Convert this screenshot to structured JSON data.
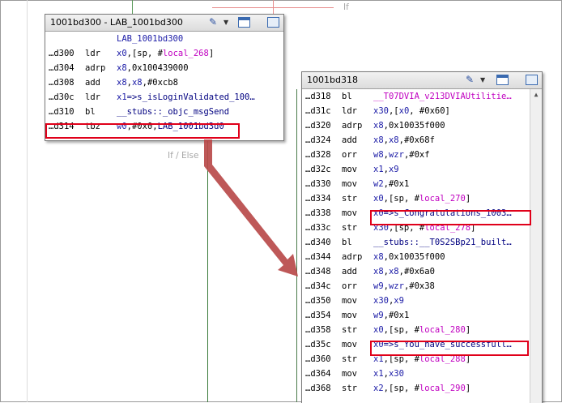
{
  "edge_labels": {
    "top_right": "If",
    "if_else": "If / Else"
  },
  "blockA": {
    "title": "1001bd300 - LAB_1001bd300",
    "label": "LAB_1001bd300",
    "rows": [
      {
        "addr": "…d300",
        "mn": "ldr",
        "op": [
          [
            "x0",
            "blue"
          ],
          [
            ",[sp, #",
            ""
          ],
          [
            "local_268",
            "mag"
          ],
          [
            "]",
            ""
          ]
        ]
      },
      {
        "addr": "…d304",
        "mn": "adrp",
        "op": [
          [
            "x8",
            "blue"
          ],
          [
            ",0x100439000",
            ""
          ]
        ]
      },
      {
        "addr": "…d308",
        "mn": "add",
        "op": [
          [
            "x8",
            "blue"
          ],
          [
            ",",
            ""
          ],
          [
            "x8",
            "blue"
          ],
          [
            ",#0xcb8",
            ""
          ]
        ]
      },
      {
        "addr": "…d30c",
        "mn": "ldr",
        "op": [
          [
            "x1",
            "blue"
          ],
          [
            "=>s_isLoginValidated_100…",
            "navy"
          ]
        ]
      },
      {
        "addr": "…d310",
        "mn": "bl",
        "op": [
          [
            "__stubs::_objc_msgSend",
            "navy"
          ]
        ]
      },
      {
        "addr": "…d314",
        "mn": "tbz",
        "op": [
          [
            "w0",
            "blue"
          ],
          [
            ",#0x0,",
            ""
          ],
          [
            "LAB_1001bd3d0",
            "navy"
          ]
        ]
      }
    ]
  },
  "blockB": {
    "title": "1001bd318",
    "rows": [
      {
        "addr": "…d318",
        "mn": "bl",
        "op": [
          [
            "__T07DVIA_v213DVIAUtilitie…",
            "mag"
          ]
        ]
      },
      {
        "addr": "…d31c",
        "mn": "ldr",
        "op": [
          [
            "x30",
            "blue"
          ],
          [
            ",[",
            ""
          ],
          [
            "x0",
            "blue"
          ],
          [
            ", #0x60]",
            ""
          ]
        ]
      },
      {
        "addr": "…d320",
        "mn": "adrp",
        "op": [
          [
            "x8",
            "blue"
          ],
          [
            ",0x10035f000",
            ""
          ]
        ]
      },
      {
        "addr": "…d324",
        "mn": "add",
        "op": [
          [
            "x8",
            "blue"
          ],
          [
            ",",
            ""
          ],
          [
            "x8",
            "blue"
          ],
          [
            ",#0x68f",
            ""
          ]
        ]
      },
      {
        "addr": "…d328",
        "mn": "orr",
        "op": [
          [
            "w8",
            "blue"
          ],
          [
            ",",
            ""
          ],
          [
            "wzr",
            "blue"
          ],
          [
            ",#0xf",
            ""
          ]
        ]
      },
      {
        "addr": "…d32c",
        "mn": "mov",
        "op": [
          [
            "x1",
            "blue"
          ],
          [
            ",",
            ""
          ],
          [
            "x9",
            "blue"
          ]
        ]
      },
      {
        "addr": "…d330",
        "mn": "mov",
        "op": [
          [
            "w2",
            "blue"
          ],
          [
            ",#0x1",
            ""
          ]
        ]
      },
      {
        "addr": "…d334",
        "mn": "str",
        "op": [
          [
            "x0",
            "blue"
          ],
          [
            ",[sp, #",
            ""
          ],
          [
            "local_270",
            "mag"
          ],
          [
            "]",
            ""
          ]
        ]
      },
      {
        "addr": "…d338",
        "mn": "mov",
        "op": [
          [
            "x0",
            "blue"
          ],
          [
            "=>s_Congratulations_1003…",
            "navy"
          ]
        ]
      },
      {
        "addr": "…d33c",
        "mn": "str",
        "op": [
          [
            "x30",
            "blue"
          ],
          [
            ",[sp, #",
            ""
          ],
          [
            "local_278",
            "mag"
          ],
          [
            "]",
            ""
          ]
        ]
      },
      {
        "addr": "…d340",
        "mn": "bl",
        "op": [
          [
            "__stubs::__T0S2SBp21_built…",
            "navy"
          ]
        ]
      },
      {
        "addr": "…d344",
        "mn": "adrp",
        "op": [
          [
            "x8",
            "blue"
          ],
          [
            ",0x10035f000",
            ""
          ]
        ]
      },
      {
        "addr": "…d348",
        "mn": "add",
        "op": [
          [
            "x8",
            "blue"
          ],
          [
            ",",
            ""
          ],
          [
            "x8",
            "blue"
          ],
          [
            ",#0x6a0",
            ""
          ]
        ]
      },
      {
        "addr": "…d34c",
        "mn": "orr",
        "op": [
          [
            "w9",
            "blue"
          ],
          [
            ",",
            ""
          ],
          [
            "wzr",
            "blue"
          ],
          [
            ",#0x38",
            ""
          ]
        ]
      },
      {
        "addr": "…d350",
        "mn": "mov",
        "op": [
          [
            "x30",
            "blue"
          ],
          [
            ",",
            ""
          ],
          [
            "x9",
            "blue"
          ]
        ]
      },
      {
        "addr": "…d354",
        "mn": "mov",
        "op": [
          [
            "w9",
            "blue"
          ],
          [
            ",#0x1",
            ""
          ]
        ]
      },
      {
        "addr": "…d358",
        "mn": "str",
        "op": [
          [
            "x0",
            "blue"
          ],
          [
            ",[sp, #",
            ""
          ],
          [
            "local_280",
            "mag"
          ],
          [
            "]",
            ""
          ]
        ]
      },
      {
        "addr": "…d35c",
        "mn": "mov",
        "op": [
          [
            "x0",
            "blue"
          ],
          [
            "=>s_You_have_successfull…",
            "navy"
          ]
        ]
      },
      {
        "addr": "…d360",
        "mn": "str",
        "op": [
          [
            "x1",
            "blue"
          ],
          [
            ",[sp, #",
            ""
          ],
          [
            "local_288",
            "mag"
          ],
          [
            "]",
            ""
          ]
        ]
      },
      {
        "addr": "…d364",
        "mn": "mov",
        "op": [
          [
            "x1",
            "blue"
          ],
          [
            ",",
            ""
          ],
          [
            "x30",
            "blue"
          ]
        ]
      },
      {
        "addr": "…d368",
        "mn": "str",
        "op": [
          [
            "x2",
            "blue"
          ],
          [
            ",[sp, #",
            ""
          ],
          [
            "local_290",
            "mag"
          ],
          [
            "]",
            ""
          ]
        ]
      }
    ]
  },
  "colors": {
    "highlight_box": "#e0001a",
    "arrow": "#b84a4a",
    "edge_true": "#4a7a4a"
  }
}
